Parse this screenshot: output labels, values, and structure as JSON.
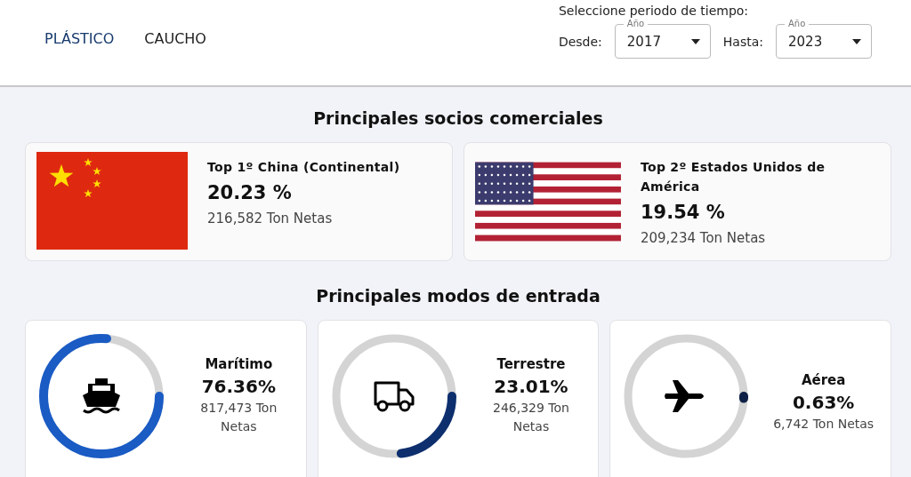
{
  "tabs": [
    {
      "label": "PLÁSTICO",
      "selected": true
    },
    {
      "label": "CAUCHO",
      "selected": false
    }
  ],
  "period": {
    "title": "Seleccione periodo de tiempo:",
    "from_label": "Desde:",
    "from_field": {
      "label": "Año",
      "value": "2017"
    },
    "to_label": "Hasta:",
    "to_field": {
      "label": "Año",
      "value": "2023"
    }
  },
  "partners": {
    "title": "Principales socios comerciales",
    "items": [
      {
        "kind": "china",
        "title": "Top 1º China (Continental)",
        "percent": "20.23 %",
        "tons": "216,582 Ton Netas"
      },
      {
        "kind": "usa",
        "title": "Top 2º Estados Unidos de América",
        "percent": "19.54 %",
        "tons": "209,234 Ton Netas"
      }
    ]
  },
  "modes": {
    "title": "Principales modos de entrada",
    "items": [
      {
        "kind": "ship",
        "name": "Marítimo",
        "percent": "76.36%",
        "tons": "817,473 Ton Netas",
        "level": 0.7636,
        "color": "#1a5bc4"
      },
      {
        "kind": "truck",
        "name": "Terrestre",
        "percent": "23.01%",
        "tons": "246,329 Ton Netas",
        "level": 0.2301,
        "color": "#0e2f6e"
      },
      {
        "kind": "plane",
        "name": "Aérea",
        "percent": "0.63%",
        "tons": "6,742 Ton Netas",
        "level": 0.0063,
        "color": "#0d1f45"
      }
    ]
  }
}
